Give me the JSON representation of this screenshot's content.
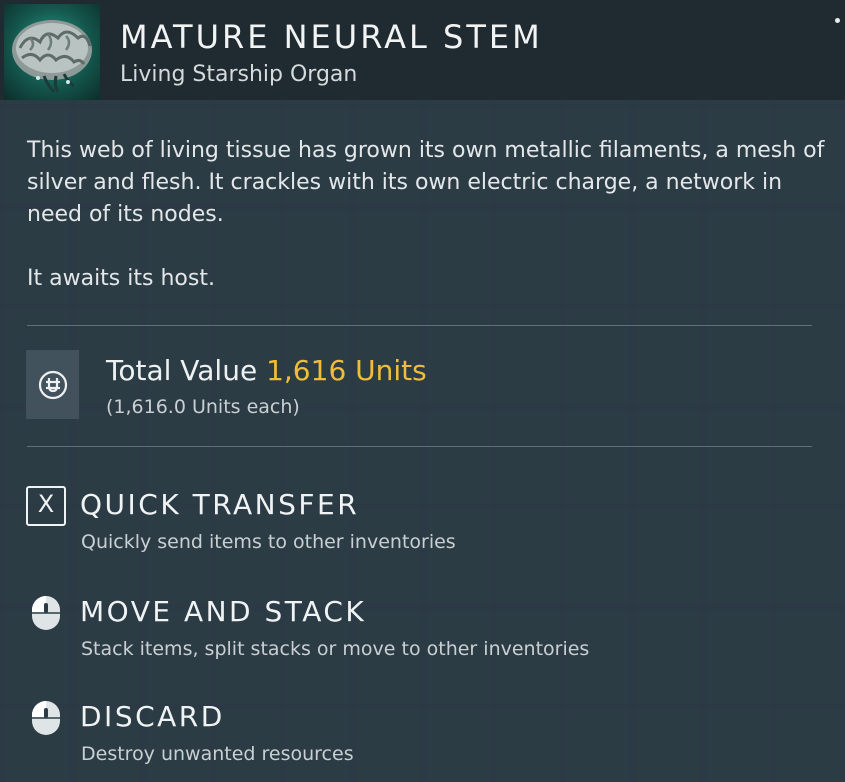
{
  "item": {
    "title": "MATURE NEURAL STEM",
    "subtitle": "Living Starship Organ",
    "icon": "neural-stem-brain-icon",
    "description": [
      "This web of living tissue has grown its own metallic filaments, a mesh of silver and flesh. It crackles with its own electric charge, a network in need of its nodes.",
      "It awaits its host."
    ]
  },
  "value": {
    "label": "Total Value",
    "amount": "1,616 Units",
    "each": "(1,616.0 Units each)",
    "icon": "units-currency-icon"
  },
  "actions": [
    {
      "key": "X",
      "title": "QUICK TRANSFER",
      "desc": "Quickly send items to other inventories",
      "icon": "x-key-icon"
    },
    {
      "title": "MOVE AND STACK",
      "desc": "Stack items, split stacks or move to other inventories",
      "icon": "mouse-left-click-icon"
    },
    {
      "title": "DISCARD",
      "desc": "Destroy unwanted resources",
      "icon": "mouse-left-click-icon"
    }
  ],
  "colors": {
    "accent_value": "#f0bd3b",
    "panel": "#2c3c46",
    "text": "#e6eaec"
  }
}
